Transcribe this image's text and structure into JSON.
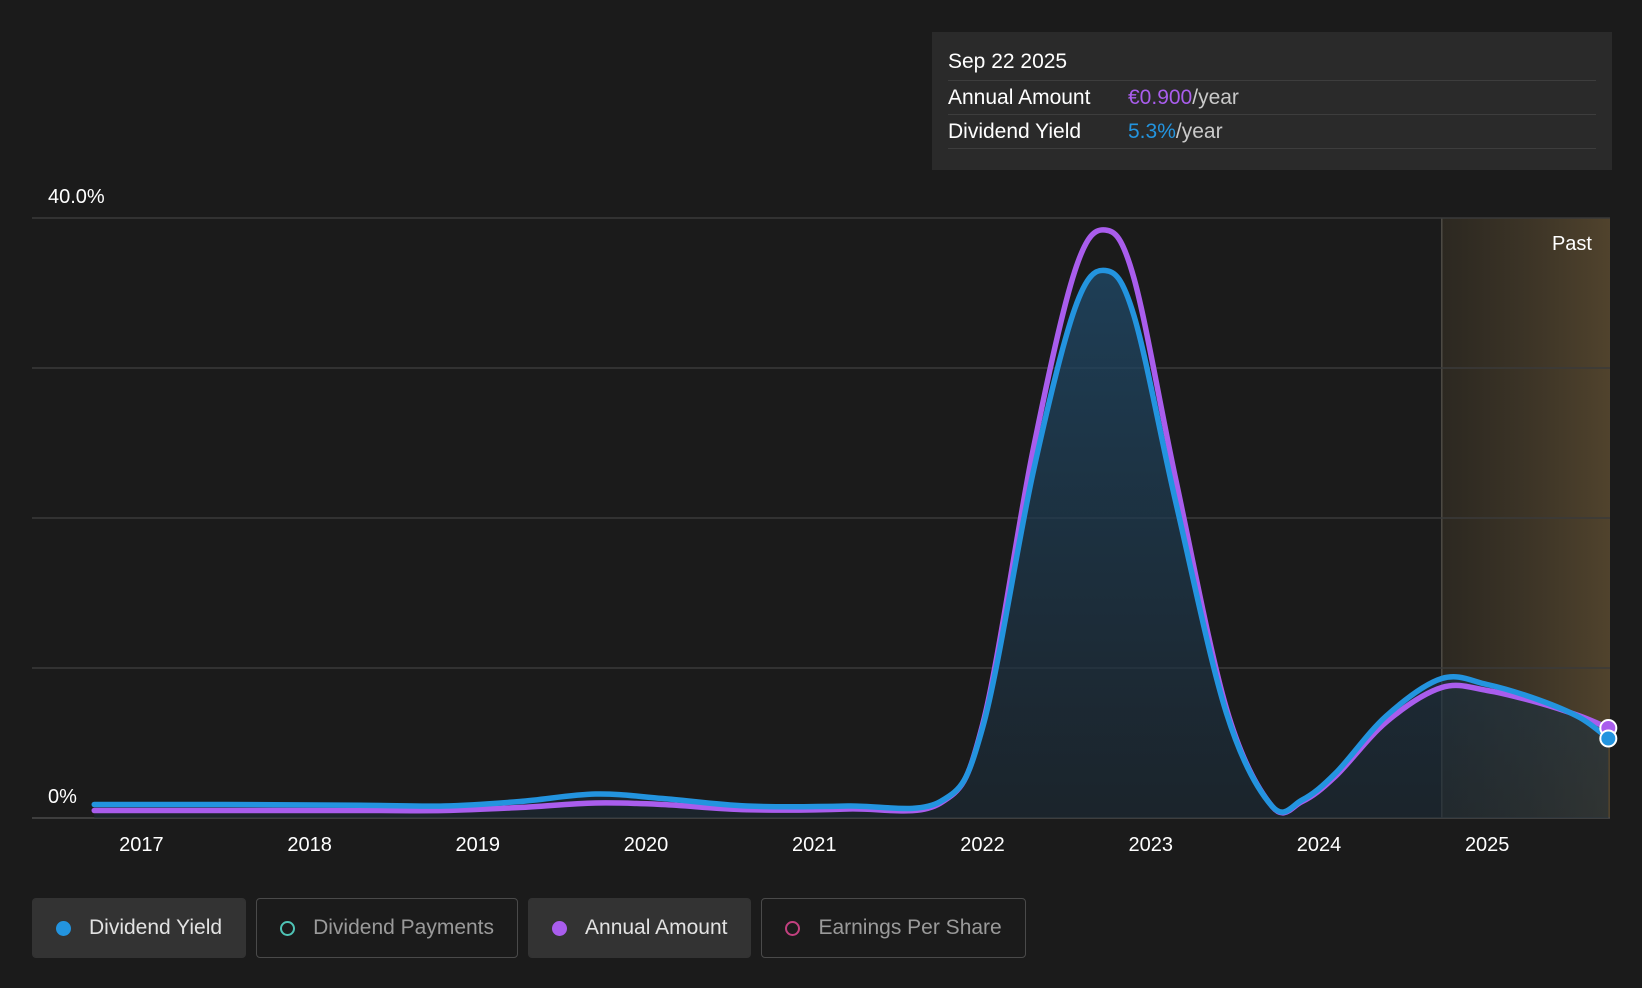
{
  "tooltip": {
    "date": "Sep 22 2025",
    "rows": [
      {
        "label": "Annual Amount",
        "value": "€0.900",
        "unit": "/year"
      },
      {
        "label": "Dividend Yield",
        "value": "5.3%",
        "unit": "/year"
      }
    ]
  },
  "past_label": "Past",
  "legend": [
    {
      "label": "Dividend Yield",
      "active": true,
      "color": "#2394df",
      "filled": true
    },
    {
      "label": "Dividend Payments",
      "active": false,
      "color": "#4fc4b6",
      "filled": false
    },
    {
      "label": "Annual Amount",
      "active": true,
      "color": "#a95ded",
      "filled": true
    },
    {
      "label": "Earnings Per Share",
      "active": false,
      "color": "#c2407f",
      "filled": false
    }
  ],
  "colors": {
    "background": "#1b1b1b",
    "dividend_yield": "#2394df",
    "annual_amount": "#a95ded",
    "gridline": "#3a3a3a",
    "past_shade": "#4a3f2c"
  },
  "chart_data": {
    "type": "area",
    "title": "",
    "xlabel": "",
    "ylabel": "",
    "y_tick_labels": [
      "0%",
      "40.0%"
    ],
    "ylim": [
      0,
      40
    ],
    "xlim": [
      2016.35,
      2025.73
    ],
    "x_tick_labels": [
      "2017",
      "2018",
      "2019",
      "2020",
      "2021",
      "2022",
      "2023",
      "2024",
      "2025"
    ],
    "x_ticks": [
      2017,
      2018,
      2019,
      2020,
      2021,
      2022,
      2023,
      2024,
      2025
    ],
    "grid_lines": [
      0,
      10,
      20,
      30,
      40
    ],
    "past_region_start": 2024.73,
    "series": [
      {
        "name": "Dividend Yield",
        "x": [
          2016.72,
          2017.5,
          2018.3,
          2018.8,
          2019.25,
          2019.7,
          2020.1,
          2020.6,
          2021.2,
          2021.75,
          2022.0,
          2022.3,
          2022.55,
          2022.73,
          2022.9,
          2023.15,
          2023.45,
          2023.72,
          2023.9,
          2024.1,
          2024.4,
          2024.73,
          2025.0,
          2025.3,
          2025.55,
          2025.72
        ],
        "values": [
          0.9,
          0.9,
          0.85,
          0.8,
          1.1,
          1.6,
          1.3,
          0.8,
          0.8,
          1.1,
          6.0,
          23.0,
          34.0,
          36.5,
          33.5,
          21.0,
          7.0,
          0.8,
          1.2,
          3.0,
          6.8,
          9.3,
          8.9,
          7.9,
          6.7,
          5.3
        ]
      },
      {
        "name": "Annual Amount",
        "x": [
          2016.72,
          2017.5,
          2018.3,
          2018.8,
          2019.25,
          2019.7,
          2020.1,
          2020.6,
          2021.2,
          2021.75,
          2022.0,
          2022.3,
          2022.55,
          2022.73,
          2022.9,
          2023.15,
          2023.45,
          2023.72,
          2023.9,
          2024.1,
          2024.4,
          2024.73,
          2025.0,
          2025.3,
          2025.55,
          2025.72
        ],
        "values": [
          0.5,
          0.5,
          0.5,
          0.5,
          0.7,
          1.0,
          0.9,
          0.55,
          0.6,
          1.0,
          6.2,
          24.5,
          36.5,
          39.2,
          36.0,
          22.5,
          7.3,
          0.8,
          1.1,
          2.8,
          6.4,
          8.7,
          8.5,
          7.7,
          6.8,
          6.0
        ]
      }
    ]
  }
}
